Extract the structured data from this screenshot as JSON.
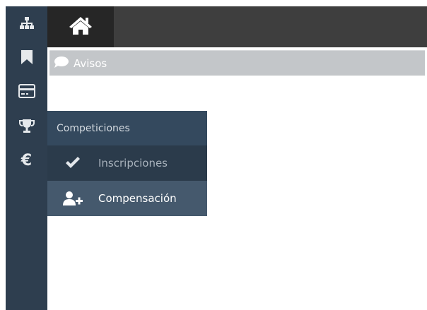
{
  "rail": {
    "items": [
      {
        "name": "sitemap-icon"
      },
      {
        "name": "bookmark-icon"
      },
      {
        "name": "credit-card-icon"
      },
      {
        "name": "trophy-icon"
      },
      {
        "name": "euro-icon",
        "glyph": "€"
      }
    ]
  },
  "topbar": {
    "home_icon": "home-icon"
  },
  "notice": {
    "label": "Avisos",
    "icon": "comment-icon"
  },
  "flyout": {
    "header": "Competiciones",
    "items": [
      {
        "label": "Inscripciones",
        "icon": "check-icon",
        "active": false
      },
      {
        "label": "Compensación",
        "icon": "user-plus-icon",
        "active": true
      }
    ]
  },
  "colors": {
    "rail_bg": "#2e3e4f",
    "topbar_bg": "#3e3e3e",
    "home_tab_bg": "#262626",
    "notice_bg": "#c3c6c9",
    "flyout_header_bg": "#34495e",
    "flyout_item_bg": "#2b3b4b",
    "flyout_active_bg": "#45596d"
  }
}
